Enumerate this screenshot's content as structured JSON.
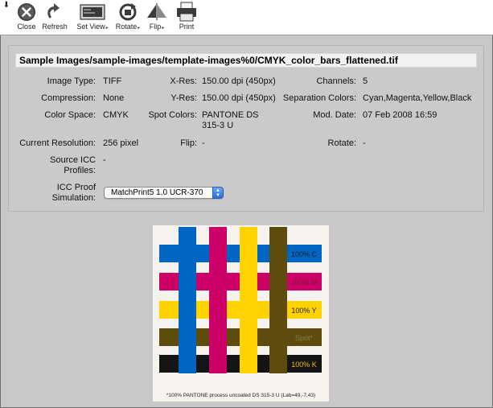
{
  "toolbar": {
    "corner_icon": "down-arrow-icon",
    "buttons": [
      {
        "label": "Close",
        "icon": "close-icon"
      },
      {
        "label": "Refresh",
        "icon": "refresh-icon"
      },
      {
        "label": "Set View",
        "icon": "set-view-icon",
        "menu": true
      },
      {
        "label": "Rotate",
        "icon": "rotate-icon",
        "menu": true
      },
      {
        "label": "Flip",
        "icon": "flip-icon",
        "menu": true
      },
      {
        "label": "Print",
        "icon": "printer-icon"
      }
    ]
  },
  "info": {
    "path": "Sample Images/sample-images/template-images%0/CMYK_color_bars_flattened.tif",
    "image_type_label": "Image Type:",
    "image_type": "TIFF",
    "xres_label": "X-Res:",
    "xres": "150.00 dpi (450px)",
    "channels_label": "Channels:",
    "channels": "5",
    "compression_label": "Compression:",
    "compression": "None",
    "yres_label": "Y-Res:",
    "yres": "150.00 dpi (450px)",
    "separation_label": "Separation Colors:",
    "separation": "Cyan,Magenta,Yellow,Black",
    "color_space_label": "Color Space:",
    "color_space": "CMYK",
    "spot_label": "Spot Colors:",
    "spot": "PANTONE DS 315-3 U",
    "mod_date_label": "Mod. Date:",
    "mod_date": "07 Feb 2008 16:59",
    "resolution_label": "Current Resolution:",
    "resolution": "256 pixel",
    "flip_label": "Flip:",
    "flip": "-",
    "rotate_label": "Rotate:",
    "rotate": "-",
    "source_icc_label": "Source ICC Profiles:",
    "source_icc": "-",
    "proof_label": "ICC Proof Simulation:",
    "proof_value": "MatchPrint5 1.0 UCR-370"
  },
  "preview": {
    "bars": [
      {
        "label": "100% C",
        "color": "#0066c4",
        "text_color": "#1a1a1a"
      },
      {
        "label": "100% M",
        "color": "#cc0066",
        "text_color": "#7a1a3a"
      },
      {
        "label": "100% Y",
        "color": "#ffd200",
        "text_color": "#1a1a1a"
      },
      {
        "label": "Spot*",
        "color": "#5e4c0c",
        "text_color": "#8a7a4a"
      },
      {
        "label": "100% K",
        "color": "#141414",
        "text_color": "#f0c000"
      }
    ],
    "footnote": "*100% PANTONE process uncoated DS 315-3 U (Lab=49,-7,43)"
  }
}
